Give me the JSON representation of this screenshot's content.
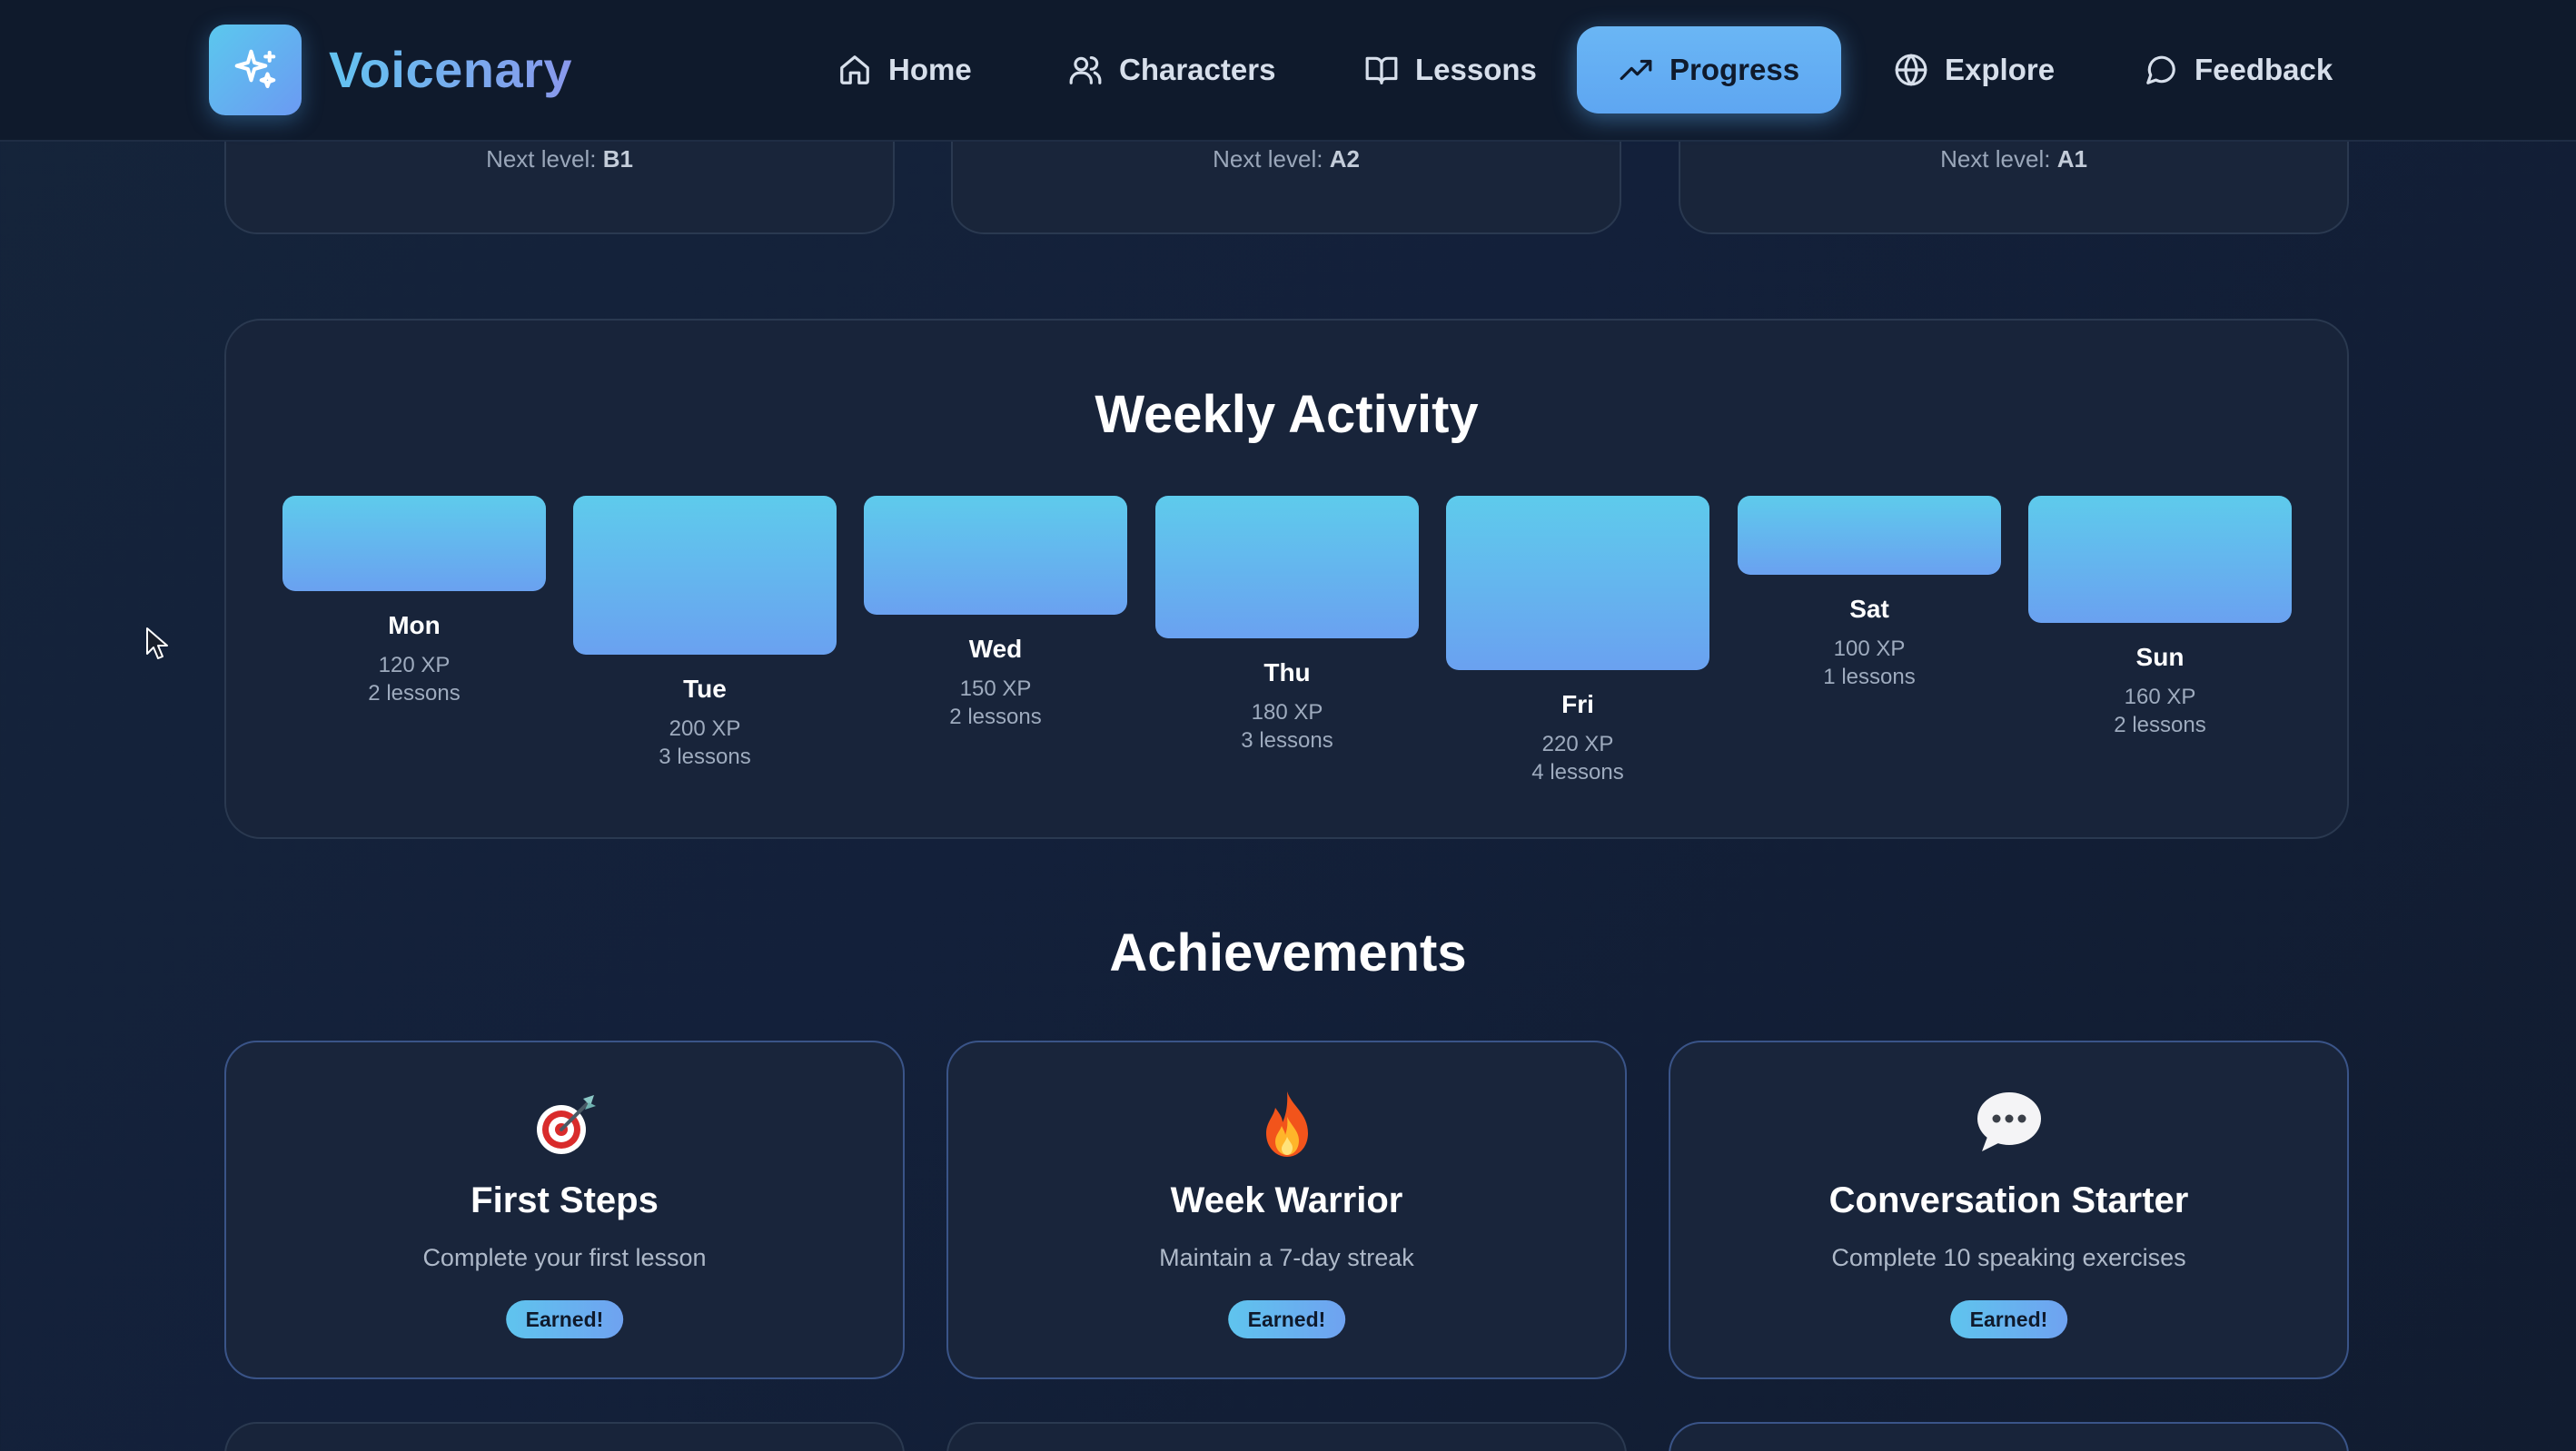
{
  "app": {
    "name": "Voicenary",
    "logo_icon": "sparkles-icon"
  },
  "nav": {
    "items": [
      {
        "label": "Home",
        "icon": "home-icon",
        "active": false
      },
      {
        "label": "Characters",
        "icon": "users-icon",
        "active": false
      },
      {
        "label": "Lessons",
        "icon": "book-icon",
        "active": false
      },
      {
        "label": "Progress",
        "icon": "trending-up-icon",
        "active": true
      },
      {
        "label": "Explore",
        "icon": "globe-icon",
        "active": false
      },
      {
        "label": "Feedback",
        "icon": "message-circle-icon",
        "active": false
      }
    ]
  },
  "level_cards": [
    {
      "prefix": "Next level:",
      "level": "B1"
    },
    {
      "prefix": "Next level:",
      "level": "A2"
    },
    {
      "prefix": "Next level:",
      "level": "A1"
    }
  ],
  "weekly_activity": {
    "title": "Weekly Activity",
    "days": [
      {
        "day": "Mon",
        "xp": 120,
        "xp_label": "120 XP",
        "lessons": 2,
        "lessons_label": "2 lessons"
      },
      {
        "day": "Tue",
        "xp": 200,
        "xp_label": "200 XP",
        "lessons": 3,
        "lessons_label": "3 lessons"
      },
      {
        "day": "Wed",
        "xp": 150,
        "xp_label": "150 XP",
        "lessons": 2,
        "lessons_label": "2 lessons"
      },
      {
        "day": "Thu",
        "xp": 180,
        "xp_label": "180 XP",
        "lessons": 3,
        "lessons_label": "3 lessons"
      },
      {
        "day": "Fri",
        "xp": 220,
        "xp_label": "220 XP",
        "lessons": 4,
        "lessons_label": "4 lessons"
      },
      {
        "day": "Sat",
        "xp": 100,
        "xp_label": "100 XP",
        "lessons": 1,
        "lessons_label": "1 lessons"
      },
      {
        "day": "Sun",
        "xp": 160,
        "xp_label": "160 XP",
        "lessons": 2,
        "lessons_label": "2 lessons"
      }
    ]
  },
  "achievements": {
    "title": "Achievements",
    "items": [
      {
        "name": "First Steps",
        "description": "Complete your first lesson",
        "badge": "Earned!",
        "icon": "target-icon"
      },
      {
        "name": "Week Warrior",
        "description": "Maintain a 7-day streak",
        "badge": "Earned!",
        "icon": "fire-icon"
      },
      {
        "name": "Conversation Starter",
        "description": "Complete 10 speaking exercises",
        "badge": "Earned!",
        "icon": "speech-bubble-icon"
      }
    ]
  },
  "colors": {
    "accent": "#62b4f2",
    "bar_top": "#5ecbec",
    "bar_bottom": "#6aa1f0",
    "background": "#14213a",
    "nav_background": "#0f1a2c"
  }
}
